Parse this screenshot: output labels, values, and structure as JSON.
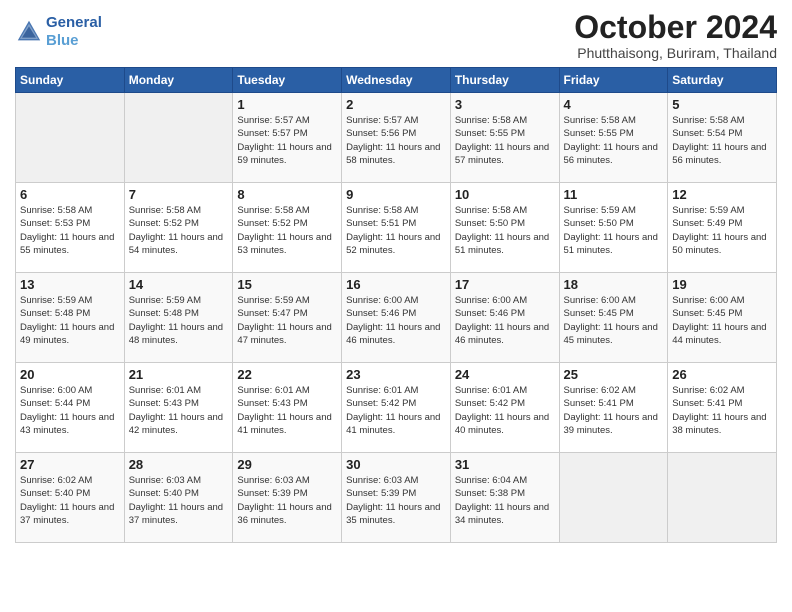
{
  "logo": {
    "line1": "General",
    "line2": "Blue"
  },
  "header": {
    "month": "October 2024",
    "location": "Phutthaisong, Buriram, Thailand"
  },
  "weekdays": [
    "Sunday",
    "Monday",
    "Tuesday",
    "Wednesday",
    "Thursday",
    "Friday",
    "Saturday"
  ],
  "weeks": [
    [
      {
        "day": "",
        "info": ""
      },
      {
        "day": "",
        "info": ""
      },
      {
        "day": "1",
        "info": "Sunrise: 5:57 AM\nSunset: 5:57 PM\nDaylight: 11 hours and 59 minutes."
      },
      {
        "day": "2",
        "info": "Sunrise: 5:57 AM\nSunset: 5:56 PM\nDaylight: 11 hours and 58 minutes."
      },
      {
        "day": "3",
        "info": "Sunrise: 5:58 AM\nSunset: 5:55 PM\nDaylight: 11 hours and 57 minutes."
      },
      {
        "day": "4",
        "info": "Sunrise: 5:58 AM\nSunset: 5:55 PM\nDaylight: 11 hours and 56 minutes."
      },
      {
        "day": "5",
        "info": "Sunrise: 5:58 AM\nSunset: 5:54 PM\nDaylight: 11 hours and 56 minutes."
      }
    ],
    [
      {
        "day": "6",
        "info": "Sunrise: 5:58 AM\nSunset: 5:53 PM\nDaylight: 11 hours and 55 minutes."
      },
      {
        "day": "7",
        "info": "Sunrise: 5:58 AM\nSunset: 5:52 PM\nDaylight: 11 hours and 54 minutes."
      },
      {
        "day": "8",
        "info": "Sunrise: 5:58 AM\nSunset: 5:52 PM\nDaylight: 11 hours and 53 minutes."
      },
      {
        "day": "9",
        "info": "Sunrise: 5:58 AM\nSunset: 5:51 PM\nDaylight: 11 hours and 52 minutes."
      },
      {
        "day": "10",
        "info": "Sunrise: 5:58 AM\nSunset: 5:50 PM\nDaylight: 11 hours and 51 minutes."
      },
      {
        "day": "11",
        "info": "Sunrise: 5:59 AM\nSunset: 5:50 PM\nDaylight: 11 hours and 51 minutes."
      },
      {
        "day": "12",
        "info": "Sunrise: 5:59 AM\nSunset: 5:49 PM\nDaylight: 11 hours and 50 minutes."
      }
    ],
    [
      {
        "day": "13",
        "info": "Sunrise: 5:59 AM\nSunset: 5:48 PM\nDaylight: 11 hours and 49 minutes."
      },
      {
        "day": "14",
        "info": "Sunrise: 5:59 AM\nSunset: 5:48 PM\nDaylight: 11 hours and 48 minutes."
      },
      {
        "day": "15",
        "info": "Sunrise: 5:59 AM\nSunset: 5:47 PM\nDaylight: 11 hours and 47 minutes."
      },
      {
        "day": "16",
        "info": "Sunrise: 6:00 AM\nSunset: 5:46 PM\nDaylight: 11 hours and 46 minutes."
      },
      {
        "day": "17",
        "info": "Sunrise: 6:00 AM\nSunset: 5:46 PM\nDaylight: 11 hours and 46 minutes."
      },
      {
        "day": "18",
        "info": "Sunrise: 6:00 AM\nSunset: 5:45 PM\nDaylight: 11 hours and 45 minutes."
      },
      {
        "day": "19",
        "info": "Sunrise: 6:00 AM\nSunset: 5:45 PM\nDaylight: 11 hours and 44 minutes."
      }
    ],
    [
      {
        "day": "20",
        "info": "Sunrise: 6:00 AM\nSunset: 5:44 PM\nDaylight: 11 hours and 43 minutes."
      },
      {
        "day": "21",
        "info": "Sunrise: 6:01 AM\nSunset: 5:43 PM\nDaylight: 11 hours and 42 minutes."
      },
      {
        "day": "22",
        "info": "Sunrise: 6:01 AM\nSunset: 5:43 PM\nDaylight: 11 hours and 41 minutes."
      },
      {
        "day": "23",
        "info": "Sunrise: 6:01 AM\nSunset: 5:42 PM\nDaylight: 11 hours and 41 minutes."
      },
      {
        "day": "24",
        "info": "Sunrise: 6:01 AM\nSunset: 5:42 PM\nDaylight: 11 hours and 40 minutes."
      },
      {
        "day": "25",
        "info": "Sunrise: 6:02 AM\nSunset: 5:41 PM\nDaylight: 11 hours and 39 minutes."
      },
      {
        "day": "26",
        "info": "Sunrise: 6:02 AM\nSunset: 5:41 PM\nDaylight: 11 hours and 38 minutes."
      }
    ],
    [
      {
        "day": "27",
        "info": "Sunrise: 6:02 AM\nSunset: 5:40 PM\nDaylight: 11 hours and 37 minutes."
      },
      {
        "day": "28",
        "info": "Sunrise: 6:03 AM\nSunset: 5:40 PM\nDaylight: 11 hours and 37 minutes."
      },
      {
        "day": "29",
        "info": "Sunrise: 6:03 AM\nSunset: 5:39 PM\nDaylight: 11 hours and 36 minutes."
      },
      {
        "day": "30",
        "info": "Sunrise: 6:03 AM\nSunset: 5:39 PM\nDaylight: 11 hours and 35 minutes."
      },
      {
        "day": "31",
        "info": "Sunrise: 6:04 AM\nSunset: 5:38 PM\nDaylight: 11 hours and 34 minutes."
      },
      {
        "day": "",
        "info": ""
      },
      {
        "day": "",
        "info": ""
      }
    ]
  ]
}
